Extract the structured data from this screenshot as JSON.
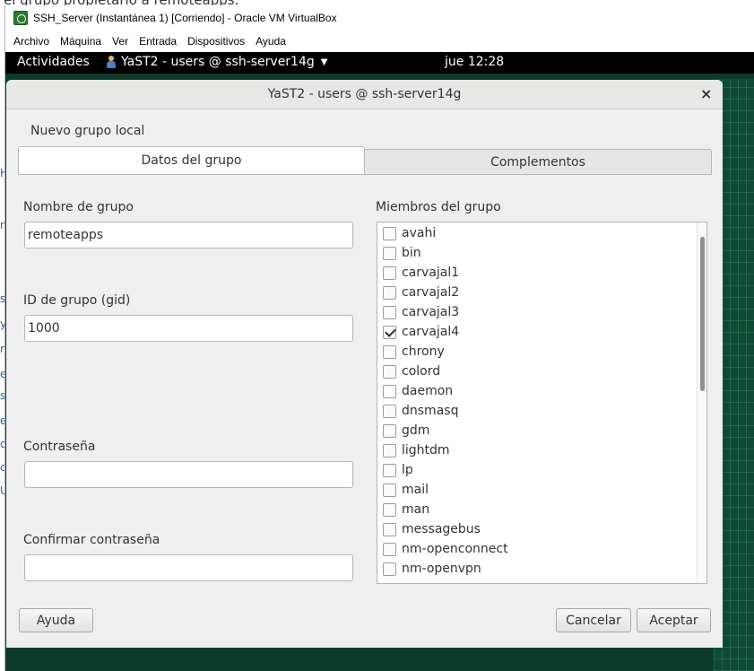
{
  "background": {
    "doc_heading": "el grupo propietario a remoteapps.",
    "side_chars": [
      "H",
      "ri",
      "s",
      "ys",
      "nc",
      "e",
      "s",
      "e",
      "d",
      "ci",
      "U"
    ]
  },
  "vbox": {
    "title": "SSH_Server (Instantánea 1) [Corriendo] - Oracle VM VirtualBox",
    "menu": [
      "Archivo",
      "Máquina",
      "Ver",
      "Entrada",
      "Dispositivos",
      "Ayuda"
    ]
  },
  "gnome": {
    "activities": "Actividades",
    "app_menu": "YaST2 - users @ ssh-server14g",
    "clock": "jue 12:28"
  },
  "dialog": {
    "title": "YaST2 - users @ ssh-server14g",
    "close": "×",
    "section_title": "Nuevo grupo local",
    "tabs": [
      "Datos del grupo",
      "Complementos"
    ],
    "group_name_label": "Nombre de grupo",
    "group_name_value": "remoteapps",
    "gid_label": "ID de grupo (gid)",
    "gid_value": "1000",
    "password_label": "Contraseña",
    "password_value": "",
    "confirm_label": "Confirmar contraseña",
    "confirm_value": "",
    "members_label": "Miembros del grupo",
    "members": [
      {
        "name": "avahi",
        "checked": false
      },
      {
        "name": "bin",
        "checked": false
      },
      {
        "name": "carvajal1",
        "checked": false
      },
      {
        "name": "carvajal2",
        "checked": false
      },
      {
        "name": "carvajal3",
        "checked": false
      },
      {
        "name": "carvajal4",
        "checked": true
      },
      {
        "name": "chrony",
        "checked": false
      },
      {
        "name": "colord",
        "checked": false
      },
      {
        "name": "daemon",
        "checked": false
      },
      {
        "name": "dnsmasq",
        "checked": false
      },
      {
        "name": "gdm",
        "checked": false
      },
      {
        "name": "lightdm",
        "checked": false
      },
      {
        "name": "lp",
        "checked": false
      },
      {
        "name": "mail",
        "checked": false
      },
      {
        "name": "man",
        "checked": false
      },
      {
        "name": "messagebus",
        "checked": false
      },
      {
        "name": "nm-openconnect",
        "checked": false
      },
      {
        "name": "nm-openvpn",
        "checked": false
      }
    ],
    "buttons": {
      "help": "Ayuda",
      "cancel": "Cancelar",
      "accept": "Aceptar"
    }
  }
}
